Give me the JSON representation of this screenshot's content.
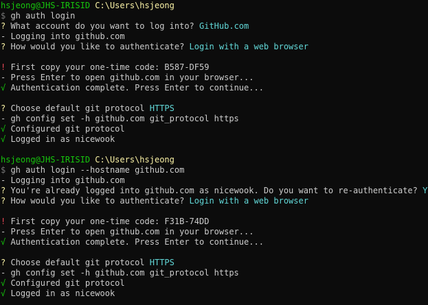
{
  "colors": {
    "background": "#0c0c0c",
    "default": "#cccccc",
    "green": "#16c60c",
    "yellow": "#f9f1a5",
    "cyan": "#61d6d6",
    "gray": "#767676",
    "red": "#e74856"
  },
  "lines": [
    {
      "segs": [
        {
          "t": "hsjeong@JHS-IRISID",
          "c": "green"
        },
        {
          "t": " "
        },
        {
          "t": "C:\\Users\\hsjeong",
          "c": "yellow"
        }
      ]
    },
    {
      "segs": [
        {
          "t": "$",
          "c": "gray"
        },
        {
          "t": " gh auth login"
        }
      ]
    },
    {
      "segs": [
        {
          "t": "?",
          "c": "yellow"
        },
        {
          "t": " What account do you want to log into? "
        },
        {
          "t": "GitHub.com",
          "c": "cyan"
        }
      ]
    },
    {
      "segs": [
        {
          "t": "- Logging into github.com"
        }
      ]
    },
    {
      "segs": [
        {
          "t": "?",
          "c": "yellow"
        },
        {
          "t": " How would you like to authenticate? "
        },
        {
          "t": "Login with a web browser",
          "c": "cyan"
        }
      ]
    },
    {
      "segs": []
    },
    {
      "segs": [
        {
          "t": "!",
          "c": "red"
        },
        {
          "t": " First copy your one-time code: B587-DF59"
        }
      ]
    },
    {
      "segs": [
        {
          "t": "- Press Enter to open github.com in your browser..."
        }
      ]
    },
    {
      "segs": [
        {
          "t": "√",
          "c": "green"
        },
        {
          "t": " Authentication complete. Press Enter to continue..."
        }
      ]
    },
    {
      "segs": []
    },
    {
      "segs": [
        {
          "t": "?",
          "c": "yellow"
        },
        {
          "t": " Choose default git protocol "
        },
        {
          "t": "HTTPS",
          "c": "cyan"
        }
      ]
    },
    {
      "segs": [
        {
          "t": "- gh config set -h github.com git_protocol https"
        }
      ]
    },
    {
      "segs": [
        {
          "t": "√",
          "c": "green"
        },
        {
          "t": " Configured git protocol"
        }
      ]
    },
    {
      "segs": [
        {
          "t": "√",
          "c": "green"
        },
        {
          "t": " Logged in as nicewook"
        }
      ]
    },
    {
      "segs": []
    },
    {
      "segs": [
        {
          "t": "hsjeong@JHS-IRISID",
          "c": "green"
        },
        {
          "t": " "
        },
        {
          "t": "C:\\Users\\hsjeong",
          "c": "yellow"
        }
      ]
    },
    {
      "segs": [
        {
          "t": "$",
          "c": "gray"
        },
        {
          "t": " gh auth login --hostname github.com"
        }
      ]
    },
    {
      "segs": [
        {
          "t": "- Logging into github.com"
        }
      ]
    },
    {
      "segs": [
        {
          "t": "?",
          "c": "yellow"
        },
        {
          "t": " You're already logged into github.com as nicewook. Do you want to re-authenticate? "
        },
        {
          "t": "Yes",
          "c": "cyan"
        }
      ]
    },
    {
      "segs": [
        {
          "t": "?",
          "c": "yellow"
        },
        {
          "t": " How would you like to authenticate? "
        },
        {
          "t": "Login with a web browser",
          "c": "cyan"
        }
      ]
    },
    {
      "segs": []
    },
    {
      "segs": [
        {
          "t": "!",
          "c": "red"
        },
        {
          "t": " First copy your one-time code: F31B-74DD"
        }
      ]
    },
    {
      "segs": [
        {
          "t": "- Press Enter to open github.com in your browser..."
        }
      ]
    },
    {
      "segs": [
        {
          "t": "√",
          "c": "green"
        },
        {
          "t": " Authentication complete. Press Enter to continue..."
        }
      ]
    },
    {
      "segs": []
    },
    {
      "segs": [
        {
          "t": "?",
          "c": "yellow"
        },
        {
          "t": " Choose default git protocol "
        },
        {
          "t": "HTTPS",
          "c": "cyan"
        }
      ]
    },
    {
      "segs": [
        {
          "t": "- gh config set -h github.com git_protocol https"
        }
      ]
    },
    {
      "segs": [
        {
          "t": "√",
          "c": "green"
        },
        {
          "t": " Configured git protocol"
        }
      ]
    },
    {
      "segs": [
        {
          "t": "√",
          "c": "green"
        },
        {
          "t": " Logged in as nicewook"
        }
      ]
    }
  ]
}
